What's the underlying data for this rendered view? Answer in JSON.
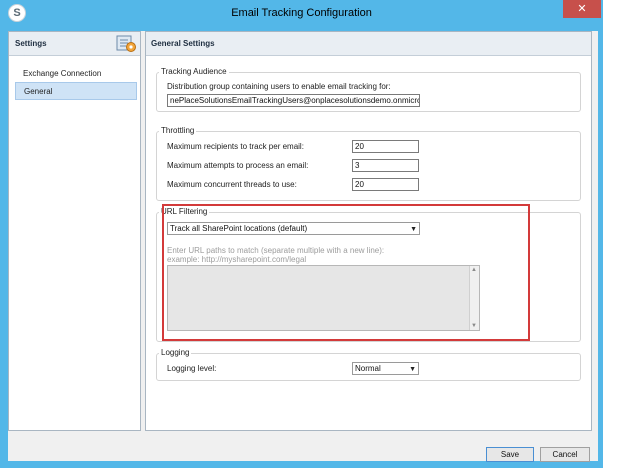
{
  "window": {
    "title": "Email Tracking Configuration",
    "close_glyph": "✕",
    "app_icon_glyph": "S"
  },
  "sidebar": {
    "header": "Settings",
    "items": [
      {
        "label": "Exchange Connection",
        "selected": false
      },
      {
        "label": "General",
        "selected": true
      }
    ]
  },
  "main": {
    "title": "General Settings",
    "tracking_audience": {
      "title": "Tracking Audience",
      "label": "Distribution group containing users to enable email tracking for:",
      "value": "nePlaceSolutionsEmailTrackingUsers@onplacesolutionsdemo.onmicrosoft.com"
    },
    "throttling": {
      "title": "Throttling",
      "fields": [
        {
          "label": "Maximum recipients to track per email:",
          "value": "20"
        },
        {
          "label": "Maximum attempts to process an email:",
          "value": "3"
        },
        {
          "label": "Maximum concurrent threads to use:",
          "value": "20"
        }
      ]
    },
    "url_filtering": {
      "title": "URL Filtering",
      "mode": "Track all SharePoint locations (default)",
      "hint_line1": "Enter URL paths to match (separate multiple with a new line):",
      "hint_line2": "example: http://mysharepoint.com/legal",
      "paths_value": ""
    },
    "logging": {
      "title": "Logging",
      "label": "Logging level:",
      "value": "Normal"
    }
  },
  "footer": {
    "save_label": "Save",
    "cancel_label": "Cancel"
  },
  "colors": {
    "frame": "#53b7e8",
    "close": "#c7504b",
    "highlight": "#d33a3a",
    "selected_item": "#cfe3f6"
  }
}
